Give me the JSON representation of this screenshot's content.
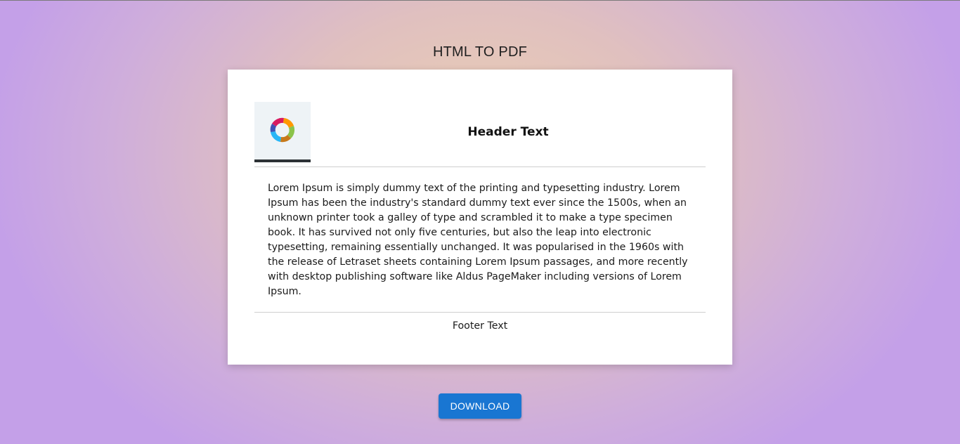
{
  "page": {
    "title": "HTML TO PDF"
  },
  "document": {
    "logo_icon": "aperture-ring-logo",
    "header_text": "Header Text",
    "body_text": "Lorem Ipsum is simply dummy text of the printing and typesetting industry. Lorem Ipsum has been the industry's standard dummy text ever since the 1500s, when an unknown printer took a galley of type and scrambled it to make a type specimen book. It has survived not only five centuries, but also the leap into electronic typesetting, remaining essentially unchanged. It was popularised in the 1960s with the release of Letraset sheets containing Lorem Ipsum passages, and more recently with desktop publishing software like Aldus PageMaker including versions of Lorem Ipsum.",
    "footer_text": "Footer Text"
  },
  "actions": {
    "download_label": "DOWNLOAD"
  },
  "colors": {
    "button": "#1976d2",
    "background_center": "#ecd0b2",
    "background_edge": "#c4a0e8"
  }
}
